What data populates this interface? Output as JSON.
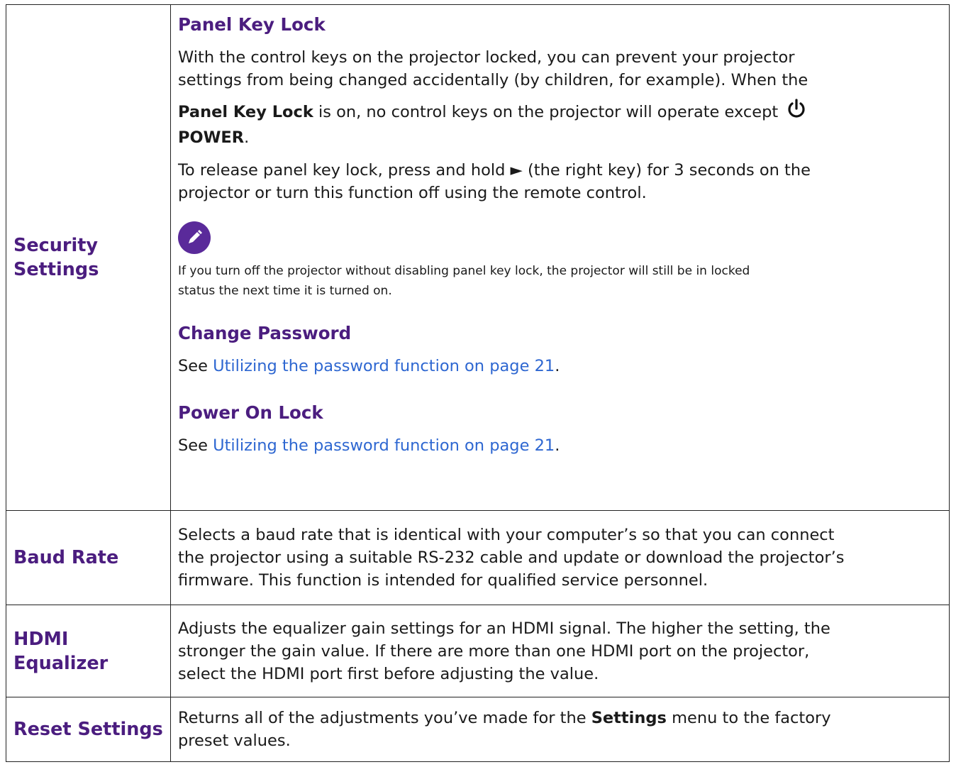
{
  "rows": [
    {
      "label_line1": "Security",
      "label_line2": "Settings",
      "panel_key_lock": {
        "heading": "Panel Key Lock",
        "para1_line1": "With the control keys on the projector locked, you can prevent your projector",
        "para1_line2": "settings from being changed accidentally (by children, for example). When the",
        "para2_bold": "Panel Key Lock",
        "para2_text": " is on, no control keys on the projector will operate except ",
        "para2_power": "POWER",
        "para2_end": ".",
        "para3_line1": "To release panel key lock, press and hold ► (the right key) for 3 seconds on the",
        "para3_line2": "projector or turn this function off using the remote control.",
        "note_icon": "pencil-icon",
        "note_line1": "If you turn off the projector without disabling panel key lock, the projector will still be in locked",
        "note_line2": "status the next time it is turned on."
      },
      "change_password": {
        "heading": "Change Password",
        "see": "See ",
        "link": "Utilizing the password function on page 21",
        "end": "."
      },
      "power_on_lock": {
        "heading": "Power On Lock",
        "see": "See ",
        "link": "Utilizing the password function on page 21",
        "end": "."
      }
    },
    {
      "label": "Baud Rate",
      "line1": "Selects a baud rate that is identical with your computer’s so that you can connect",
      "line2": "the projector using a suitable RS-232 cable and update or download the projector’s",
      "line3": "firmware. This function is intended for qualified service personnel."
    },
    {
      "label_line1": "HDMI",
      "label_line2": "Equalizer",
      "line1": "Adjusts the equalizer gain settings for an HDMI signal. The higher the setting, the",
      "line2": "stronger the gain value. If there are more than one HDMI port on the projector,",
      "line3": "select the HDMI port first before adjusting the value."
    },
    {
      "label": "Reset Settings",
      "line1_text": "Returns all of the adjustments you’ve made for the ",
      "line1_bold": "Settings",
      "line1_end": " menu to the factory",
      "line2": "preset values."
    }
  ],
  "colors": {
    "heading_purple": "#4b1d7f",
    "link_blue": "#2e67d1",
    "icon_purple": "#5a2a9a",
    "border": "#222222"
  }
}
